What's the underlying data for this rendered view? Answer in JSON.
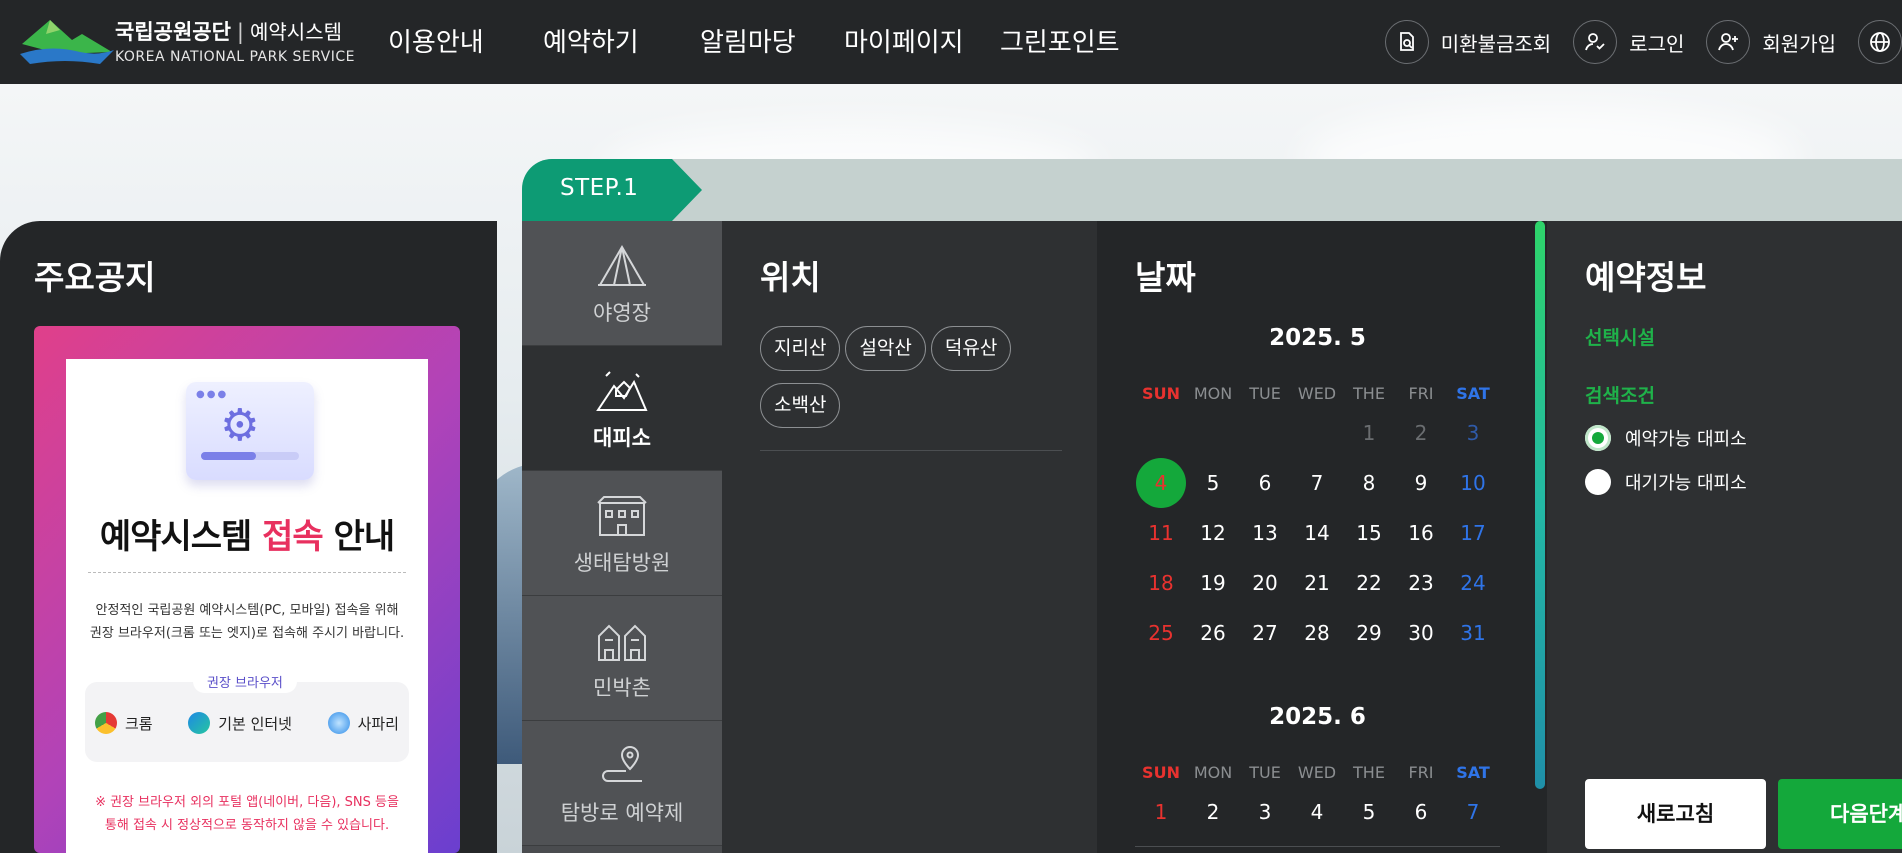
{
  "header": {
    "logo_name": "국립공원공단",
    "logo_system": "예약시스템",
    "logo_english": "KOREA NATIONAL PARK SERVICE",
    "nav": [
      "이용안내",
      "예약하기",
      "알림마당",
      "마이페이지",
      "그린포인트"
    ],
    "util": {
      "refund": "미환불금조회",
      "login": "로그인",
      "signup": "회원가입"
    }
  },
  "notice": {
    "title": "주요공지",
    "headline_a": "예약시스템",
    "headline_b": "접속",
    "headline_c": "안내",
    "desc_line1": "안정적인 국립공원 예약시스템(PC, 모바일) 접속을 위해",
    "desc_line2": "권장 브라우저(크롬 또는 엣지)로  접속해 주시기 바랍니다.",
    "browser_tag": "권장 브라우저",
    "browsers": [
      "크롬",
      "기본 인터넷",
      "사파리"
    ],
    "warn_line1": "※ 권장 브라우저 외의 포털 앱(네이버, 다음), SNS 등을",
    "warn_line2": "통해 접속 시 정상적으로 동작하지 않을 수 있습니다."
  },
  "step": {
    "label": "STEP.1"
  },
  "categories": [
    {
      "label": "야영장",
      "icon": "tent-icon",
      "active": false
    },
    {
      "label": "대피소",
      "icon": "shelter-icon",
      "active": true
    },
    {
      "label": "생태탐방원",
      "icon": "building-icon",
      "active": false
    },
    {
      "label": "민박촌",
      "icon": "houses-icon",
      "active": false
    },
    {
      "label": "탐방로 예약제",
      "icon": "trail-pin-icon",
      "active": false
    }
  ],
  "location": {
    "title": "위치",
    "chips": [
      "지리산",
      "설악산",
      "덕유산",
      "소백산"
    ]
  },
  "date": {
    "title": "날짜",
    "weekdays": [
      "SUN",
      "MON",
      "TUE",
      "WED",
      "THE",
      "FRI",
      "SAT"
    ],
    "months": [
      {
        "label": "2025. 5",
        "weeks": [
          [
            "",
            "",
            "",
            "",
            "1",
            "2",
            "3"
          ],
          [
            "4",
            "5",
            "6",
            "7",
            "8",
            "9",
            "10"
          ],
          [
            "11",
            "12",
            "13",
            "14",
            "15",
            "16",
            "17"
          ],
          [
            "18",
            "19",
            "20",
            "21",
            "22",
            "23",
            "24"
          ],
          [
            "25",
            "26",
            "27",
            "28",
            "29",
            "30",
            "31"
          ]
        ],
        "dim_days": [
          "1",
          "2",
          "3"
        ],
        "selected_day": "4"
      },
      {
        "label": "2025. 6",
        "weeks": [
          [
            "1",
            "2",
            "3",
            "4",
            "5",
            "6",
            "7"
          ]
        ]
      }
    ]
  },
  "info": {
    "title": "예약정보",
    "selected_facility_label": "선택시설",
    "search_condition_label": "검색조건",
    "options": [
      {
        "label": "예약가능 대피소",
        "checked": true
      },
      {
        "label": "대기가능 대피소",
        "checked": false
      }
    ],
    "refresh_label": "새로고침",
    "next_label": "다음단계"
  },
  "colors": {
    "header_bg": "#242628",
    "accent_green": "#14a83b",
    "step_teal": "#0d9b74",
    "sunday_red": "#e8322f",
    "saturday_blue": "#2f74e8",
    "notice_pink": "#e8305f"
  }
}
